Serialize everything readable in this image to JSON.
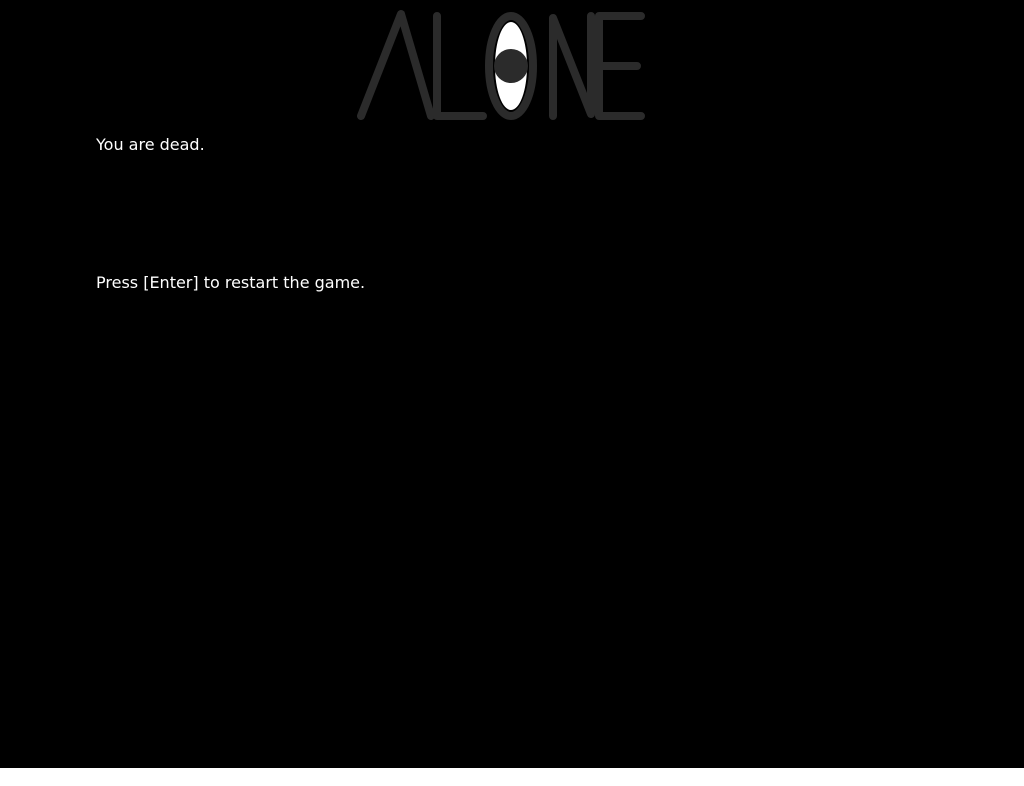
{
  "game": {
    "logo_text": "ALONE",
    "death_message": "You are dead.",
    "restart_prompt": "Press [Enter] to restart the game."
  },
  "colors": {
    "background": "#000000",
    "text": "#ffffff",
    "logo": "#2b2b2b",
    "logo_eye": "#ffffff"
  }
}
